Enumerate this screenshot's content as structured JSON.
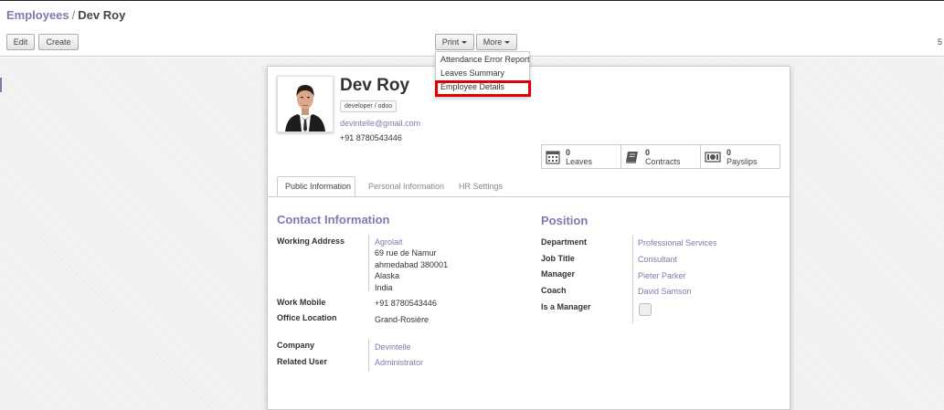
{
  "breadcrumb": {
    "parent": "Employees",
    "separator": "/",
    "current": "Dev Roy"
  },
  "toolbar": {
    "edit_label": "Edit",
    "create_label": "Create",
    "print_label": "Print",
    "more_label": "More"
  },
  "pager": {
    "text": "5"
  },
  "print_menu": {
    "items": [
      "Attendance Error Report",
      "Leaves Summary",
      "Employee Details"
    ],
    "highlighted": "Employee Details"
  },
  "employee": {
    "name": "Dev Roy",
    "tag": "developer / odoo",
    "email": "devintelle@gmail.com",
    "phone": "+91 8780543446"
  },
  "stats": [
    {
      "count": "0",
      "label": "Leaves",
      "icon": "calendar-icon"
    },
    {
      "count": "0",
      "label": "Contracts",
      "icon": "book-icon"
    },
    {
      "count": "0",
      "label": "Payslips",
      "icon": "money-icon"
    }
  ],
  "tabs": [
    "Public Information",
    "Personal Information",
    "HR Settings"
  ],
  "contact": {
    "title": "Contact Information",
    "working_address_label": "Working Address",
    "working_address_company": "Agrolait",
    "working_address_lines": [
      "69 rue de Namur",
      "ahmedabad 380001",
      "Alaska",
      "India"
    ],
    "work_mobile_label": "Work Mobile",
    "work_mobile": "+91 8780543446",
    "office_location_label": "Office Location",
    "office_location": "Grand-Rosière",
    "company_label": "Company",
    "company": "Devintelle",
    "related_user_label": "Related User",
    "related_user": "Administrator"
  },
  "position": {
    "title": "Position",
    "department_label": "Department",
    "department": "Professional Services",
    "job_title_label": "Job Title",
    "job_title": "Consultant",
    "manager_label": "Manager",
    "manager": "Pieter Parker",
    "coach_label": "Coach",
    "coach": "David Samson",
    "is_manager_label": "Is a Manager",
    "is_manager": false
  },
  "colors": {
    "accent": "#7c7bad",
    "highlight": "#e00000"
  }
}
